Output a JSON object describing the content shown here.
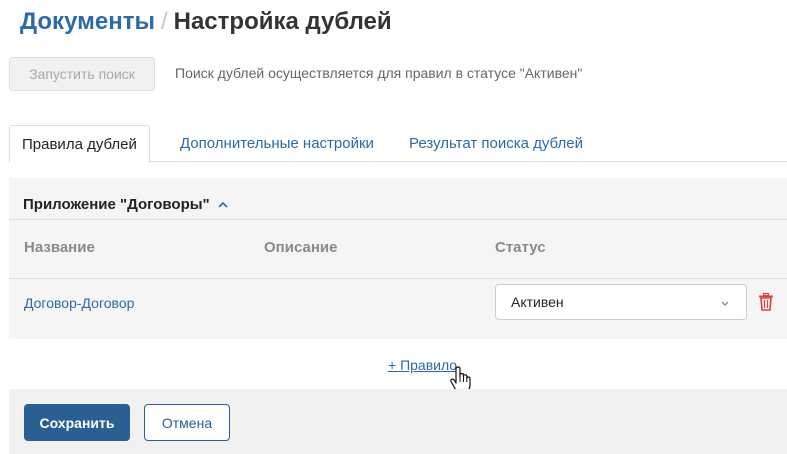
{
  "header": {
    "breadcrumb_root": "Документы",
    "separator": "/",
    "page_title": "Настройка дублей"
  },
  "toolbar": {
    "run_search_label": "Запустить поиск",
    "hint": "Поиск дублей осуществляется для правил в статусе \"Активен\""
  },
  "tabs": [
    {
      "label": "Правила дублей",
      "active": true
    },
    {
      "label": "Дополнительные настройки",
      "active": false
    },
    {
      "label": "Результат поиска дублей",
      "active": false
    }
  ],
  "section": {
    "title": "Приложение \"Договоры\"",
    "columns": {
      "name": "Название",
      "description": "Описание",
      "status": "Статус"
    },
    "rules": [
      {
        "name": "Договор-Договор",
        "description": "",
        "status": "Активен"
      }
    ]
  },
  "add_rule_label": "+ Правило",
  "footer": {
    "save_label": "Сохранить",
    "cancel_label": "Отмена"
  },
  "colors": {
    "link": "#2d6aa6",
    "primary": "#2a5f93",
    "danger": "#e0403f"
  },
  "icons": [
    "chevron-up-icon",
    "chevron-down-icon",
    "trash-icon",
    "hand-cursor-icon"
  ]
}
